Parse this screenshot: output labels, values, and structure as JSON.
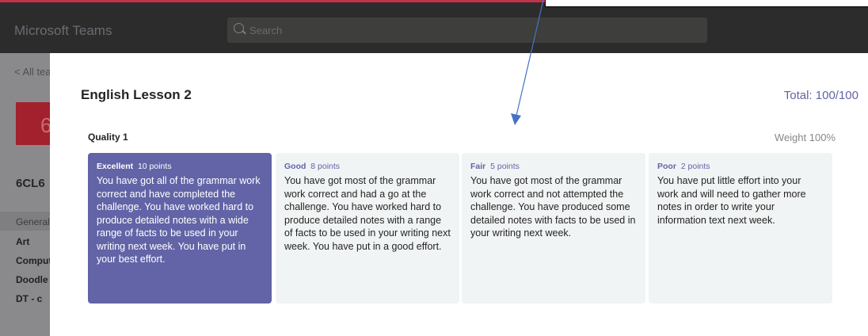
{
  "app": {
    "title": "Microsoft Teams"
  },
  "search": {
    "placeholder": "Search"
  },
  "sidebar": {
    "back_label": "< All teams",
    "team_number": "6",
    "team_name": "6CL6",
    "channels": [
      "General",
      "Art",
      "Computing",
      "Doodle",
      "DT - c"
    ]
  },
  "rubric": {
    "title": "English Lesson 2",
    "total": "Total: 100/100",
    "criterion": "Quality 1",
    "weight": "Weight 100%",
    "levels": [
      {
        "name": "Excellent",
        "points": "10 points",
        "description": "You have got all of the grammar work correct and have completed the challenge. You have worked hard to produce detailed notes with a wide range of facts to be used in your writing next week. You have put in your best effort.",
        "selected": true
      },
      {
        "name": "Good",
        "points": "8 points",
        "description": "You have got most of the grammar work correct and had a go at the challenge. You have worked hard to produce detailed notes with a range of facts to be used in your writing next week. You have put in a good effort.",
        "selected": false
      },
      {
        "name": "Fair",
        "points": "5 points",
        "description": "You have got most of the grammar work correct and not attempted the challenge. You have produced some detailed notes with facts to be used in your writing next week.",
        "selected": false
      },
      {
        "name": "Poor",
        "points": "2 points",
        "description": "You have put little effort into your work and will need to gather more notes in order to write your information text next week.",
        "selected": false
      }
    ]
  },
  "colors": {
    "accent": "#6264a7",
    "titlebar": "#2d2c2c",
    "team_tile": "#a3202d",
    "annotation_arrow": "#4472c4"
  }
}
